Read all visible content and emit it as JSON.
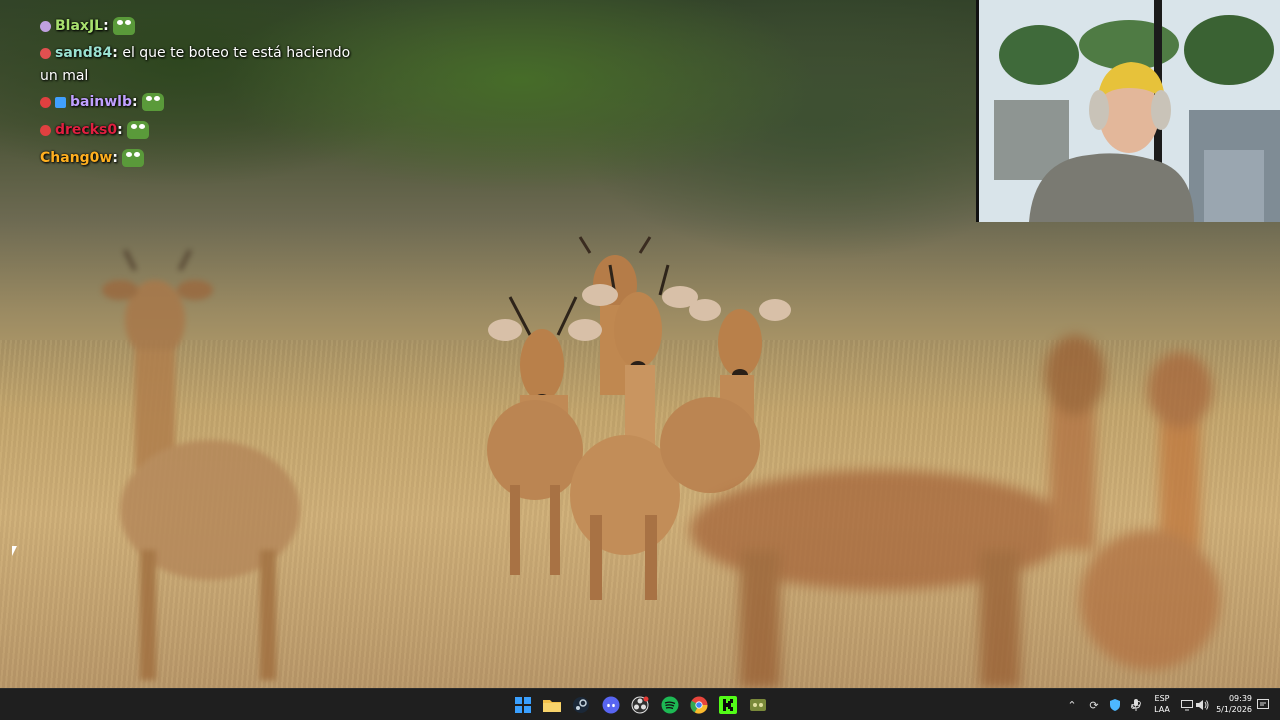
{
  "chat": {
    "messages": [
      {
        "user": "BlaxJL",
        "user_color": "#a8e06e",
        "text": "",
        "badge_colors": [
          "#c0a0e0"
        ],
        "emote": "pepe"
      },
      {
        "user": "sand84",
        "user_color": "#9ae0d0",
        "text": " el que te boteo te está haciendo un mal",
        "badge_colors": [
          "#e05050"
        ],
        "emote": ""
      },
      {
        "user": "bainwlb",
        "user_color": "#c0a0ff",
        "text": "",
        "badge_colors": [
          "#e04040",
          "#40a0ff"
        ],
        "emote": "pepe"
      },
      {
        "user": "drecks0",
        "user_color": "#e02040",
        "text": "",
        "badge_colors": [
          "#e04040"
        ],
        "emote": "pepe"
      },
      {
        "user": "Chang0w",
        "user_color": "#ffb020",
        "text": "",
        "badge_colors": [],
        "emote": "pepe"
      }
    ]
  },
  "webcam": {
    "label": "streamer-webcam"
  },
  "taskbar": {
    "icons": [
      {
        "name": "windows-start-icon",
        "color": "#3aa0ff"
      },
      {
        "name": "file-explorer-icon",
        "color": "#f2c04a"
      },
      {
        "name": "steam-icon",
        "color": "#1b2838"
      },
      {
        "name": "discord-icon",
        "color": "#5865f2"
      },
      {
        "name": "obs-icon",
        "color": "#303030"
      },
      {
        "name": "spotify-icon",
        "color": "#1db954"
      },
      {
        "name": "chrome-icon",
        "color": "#e8453c"
      },
      {
        "name": "kick-icon",
        "color": "#53fc18"
      },
      {
        "name": "game-controller-icon",
        "color": "#7a8a3a"
      }
    ],
    "language_line1": "ESP",
    "language_line2": "LAA",
    "time": "09:39",
    "date": "5/1/2026"
  },
  "colors": {
    "taskbar_bg": "#1f1f1f",
    "chat_text": "#ffffff"
  }
}
